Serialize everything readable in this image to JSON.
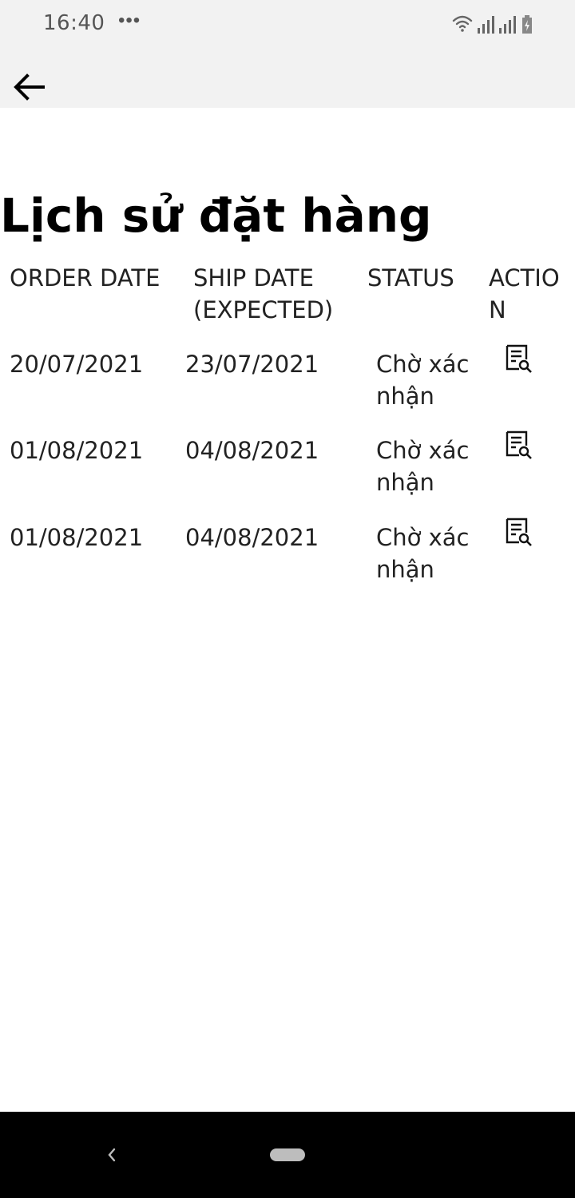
{
  "status_bar": {
    "time": "16:40",
    "dots": "•••",
    "icons": [
      "wifi-icon",
      "signal-icon",
      "signal-icon",
      "battery-charging-icon"
    ]
  },
  "app_bar": {
    "back_icon": "arrow-left-icon"
  },
  "page": {
    "title": "Lịch sử đặt hàng"
  },
  "table": {
    "headers": {
      "order_date": "ORDER DATE",
      "ship_date_line1": "SHIP DATE",
      "ship_date_line2": "(EXPECTED)",
      "status": "STATUS",
      "action_line1": "ACTIO",
      "action_line2": "N"
    },
    "rows": [
      {
        "order_date": "20/07/2021",
        "ship_date": "23/07/2021",
        "status_line1": "Chờ xác",
        "status_line2": "nhận",
        "action_icon": "document-search-icon"
      },
      {
        "order_date": "01/08/2021",
        "ship_date": "04/08/2021",
        "status_line1": "Chờ xác",
        "status_line2": "nhận",
        "action_icon": "document-search-icon"
      },
      {
        "order_date": "01/08/2021",
        "ship_date": "04/08/2021",
        "status_line1": "Chờ xác",
        "status_line2": "nhận",
        "action_icon": "document-search-icon"
      }
    ]
  },
  "nav_bar": {
    "back_icon": "chevron-left-icon",
    "home_icon": "home-pill-icon"
  },
  "colors": {
    "bar_background": "#f2f2f2",
    "nav_background": "#000000",
    "text": "#222222"
  }
}
